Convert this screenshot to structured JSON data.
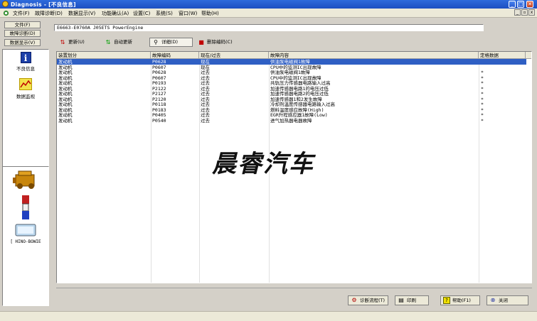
{
  "window": {
    "title": "Diagnosis - [不良信息]"
  },
  "menu": [
    "文件(F)",
    "故障诊断(D)",
    "数据显示(V)",
    "功能确认(A)",
    "设置(C)",
    "系统(S)",
    "窗口(W)",
    "帮助(H)"
  ],
  "sidebar": {
    "buttons": [
      "文件(F)",
      "故障诊断(D)",
      "数据显示(V)"
    ],
    "items": [
      {
        "label": "不良信息",
        "icon": "info-icon"
      },
      {
        "label": "数据监视",
        "icon": "data-monitor-icon"
      }
    ],
    "devices": [
      {
        "icon": "engine-icon"
      },
      {
        "icon": "usb-connector-icon"
      },
      {
        "icon": "device-icon",
        "label": "[ HINO-BOWIE"
      }
    ]
  },
  "vehicle": {
    "name": "E6663-E0760A J05ETS PowerEngine"
  },
  "toolbar": {
    "update": "更新(U)",
    "auto_update": "自动更新",
    "detail": "详细(D)",
    "delete_code": "删除编码(C)"
  },
  "table": {
    "headers": [
      "装置划分",
      "故障编码",
      "现在/过去",
      "故障内容",
      "定格数据"
    ],
    "rows": [
      {
        "device": "发动机",
        "code": "P0628",
        "state": "现在",
        "content": "供油泵电磁阀1故障",
        "freeze": "",
        "selected": true
      },
      {
        "device": "发动机",
        "code": "P0607",
        "state": "现在",
        "content": "CPU中的监测IC出现故障",
        "freeze": ""
      },
      {
        "device": "发动机",
        "code": "P0628",
        "state": "过去",
        "content": "供油泵电磁阀1故障",
        "freeze": "*"
      },
      {
        "device": "发动机",
        "code": "P0607",
        "state": "过去",
        "content": "CPU中的监测IC出现故障",
        "freeze": "*"
      },
      {
        "device": "发动机",
        "code": "P0193",
        "state": "过去",
        "content": "共轨压力传感器电路输入过高",
        "freeze": "*"
      },
      {
        "device": "发动机",
        "code": "P2122",
        "state": "过去",
        "content": "加速传感器电路1的电压过低",
        "freeze": "*"
      },
      {
        "device": "发动机",
        "code": "P2127",
        "state": "过去",
        "content": "加速传感器电路2的电压过低",
        "freeze": "*"
      },
      {
        "device": "发动机",
        "code": "P2120",
        "state": "过去",
        "content": "加速传感器1和2发生故障",
        "freeze": "*"
      },
      {
        "device": "发动机",
        "code": "P0118",
        "state": "过去",
        "content": "冷却剂温度传感器电路输入过高",
        "freeze": "*"
      },
      {
        "device": "发动机",
        "code": "P0183",
        "state": "过去",
        "content": "燃料温度感应故障(High)",
        "freeze": "*"
      },
      {
        "device": "发动机",
        "code": "P0405",
        "state": "过去",
        "content": "EGR升程感应器1故障(Low)",
        "freeze": "*"
      },
      {
        "device": "发动机",
        "code": "P0540",
        "state": "过去",
        "content": "进气加热器电器故障",
        "freeze": "*"
      }
    ]
  },
  "watermark": "晨睿汽车",
  "footer": {
    "flow": "诊断流程(T)",
    "print": "印刷",
    "help": "帮助(F1)",
    "close": "关闭"
  },
  "colors": {
    "selection": "#2f5fc4",
    "titlebar": "#1d4fc1"
  }
}
